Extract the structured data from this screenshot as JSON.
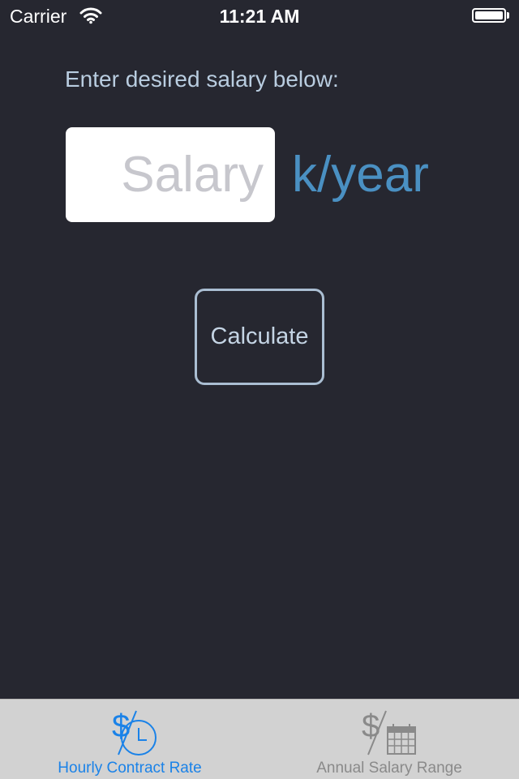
{
  "status_bar": {
    "carrier": "Carrier",
    "time": "11:21 AM",
    "wifi_icon": "wifi-icon",
    "battery_icon": "battery-icon"
  },
  "main": {
    "prompt": "Enter desired salary below:",
    "salary_input": {
      "placeholder": "Salary",
      "value": ""
    },
    "unit": "k/year",
    "calculate_label": "Calculate"
  },
  "tab_bar": {
    "tabs": [
      {
        "label": "Hourly Contract Rate",
        "icon": "dollar-clock-icon",
        "selected": true
      },
      {
        "label": "Annual Salary Range",
        "icon": "dollar-calendar-icon",
        "selected": false
      }
    ]
  },
  "colors": {
    "background": "#262730",
    "accent": "#4a90c2",
    "tab_selected": "#1a82e8",
    "tab_unselected": "#8a8a8a"
  }
}
